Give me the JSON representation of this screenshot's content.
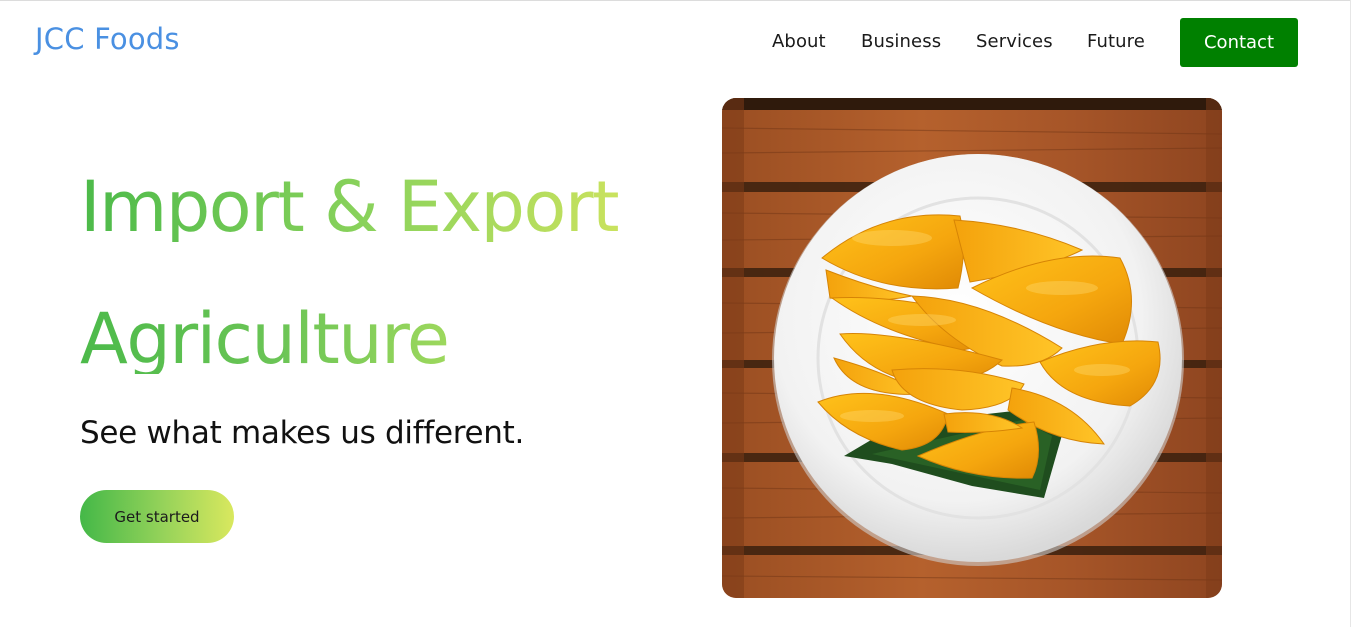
{
  "header": {
    "brand": "JCC Foods",
    "nav": [
      "About",
      "Business",
      "Services",
      "Future"
    ],
    "contact_label": "Contact"
  },
  "hero": {
    "title_line1": "Import & Export",
    "title_line2": "Agriculture",
    "subtitle": "See what makes us different.",
    "cta_label": "Get started"
  },
  "colors": {
    "brand_blue": "#4a90e2",
    "contact_green": "#008000",
    "gradient_start": "#4cba4a",
    "gradient_end": "#c9e25e"
  },
  "image": {
    "subject": "sliced mango on a white plate over a wooden table"
  }
}
